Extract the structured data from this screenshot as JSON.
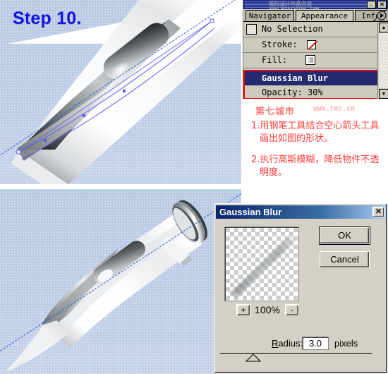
{
  "document": {
    "step_label": "Step 10."
  },
  "palette": {
    "watermark_line1": "图形设计作品交流",
    "watermark_line2": "WWW.MISSYUAN.COM",
    "minimize_glyph": "_",
    "close_glyph": "✕",
    "tabs": [
      {
        "label": "Navigator",
        "active": false
      },
      {
        "label": "Appearance",
        "active": true
      },
      {
        "label": "Info",
        "active": false
      }
    ],
    "rows": {
      "selection": "No Selection",
      "stroke_label": "Stroke:",
      "fill_label": "Fill:",
      "effect_label": "Gaussian Blur",
      "opacity_label": "Opacity: 30%"
    },
    "highlight_color": "#242a6e",
    "annotation_box_color": "#ee0000",
    "scroll_up_glyph": "▲",
    "scroll_down_glyph": "▼",
    "tab_arrow_glyph": "▶"
  },
  "notes": {
    "brand": "第七城市",
    "url": "WWW.TH7.CN",
    "items": [
      "1.用钢笔工具结合空心箭头工具画出如图的形状。",
      "2.执行高斯模糊，降低物件不透明度。"
    ],
    "text_color": "#ff3b3b"
  },
  "dialog": {
    "title": "Gaussian Blur",
    "close_glyph": "✕",
    "zoom_in": "+",
    "zoom_out": "-",
    "zoom_level": "100%",
    "ok_label": "OK",
    "cancel_label": "Cancel",
    "radius_label": "Radius:",
    "radius_value": "3.0",
    "radius_units": "pixels"
  },
  "colors": {
    "canvas_blue": "#bdcce6",
    "palette_face": "#cdcabb",
    "dialog_face": "#d4d0c8",
    "title_blue": "#0a246a",
    "step_blue": "#1515e8"
  }
}
